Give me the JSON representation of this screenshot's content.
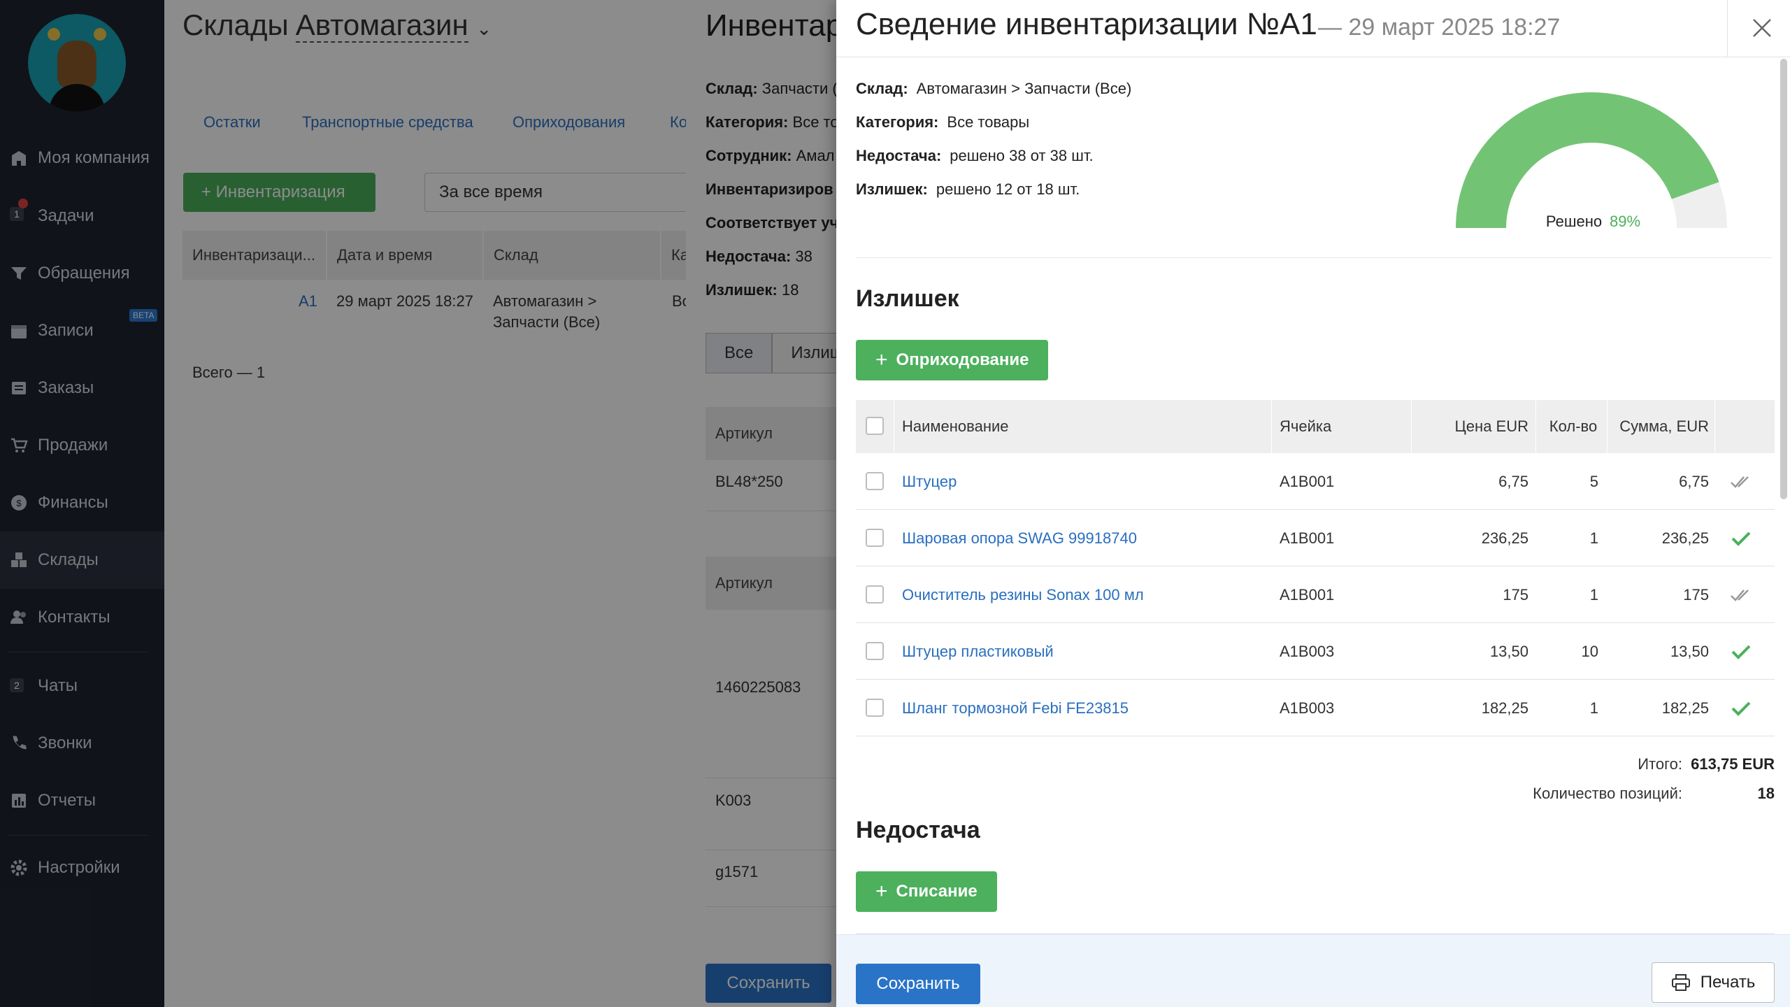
{
  "sidebar": {
    "items": [
      {
        "label": "Моя компания",
        "icon": "building-icon"
      },
      {
        "label": "Задачи",
        "icon": "tasks-icon",
        "badge": "1"
      },
      {
        "label": "Обращения",
        "icon": "funnel-icon"
      },
      {
        "label": "Записи",
        "icon": "calendar-icon",
        "tag": "BETA"
      },
      {
        "label": "Заказы",
        "icon": "orders-icon"
      },
      {
        "label": "Продажи",
        "icon": "cart-icon"
      },
      {
        "label": "Финансы",
        "icon": "coin-icon"
      },
      {
        "label": "Склады",
        "icon": "boxes-icon"
      },
      {
        "label": "Контакты",
        "icon": "contacts-icon"
      },
      {
        "label": "Чаты",
        "icon": "chat-icon",
        "badge": "2"
      },
      {
        "label": "Звонки",
        "icon": "phone-icon"
      },
      {
        "label": "Отчеты",
        "icon": "reports-icon"
      },
      {
        "label": "Настройки",
        "icon": "gear-icon"
      }
    ]
  },
  "main": {
    "title_prefix": "Склады",
    "title_warehouse": "Автомагазин",
    "tabs": [
      "Остатки",
      "Транспортные средства",
      "Оприходования",
      "Ко"
    ],
    "inventory_button": "+ Инвентаризация",
    "period": "За все время",
    "table": {
      "headers": [
        "Инвентаризаци...",
        "Дата и время",
        "Склад",
        "Ка"
      ],
      "rows": [
        [
          "A1",
          "29 март 2025 18:27",
          "Автомагазин > Запчасти (Все)",
          "Во"
        ]
      ]
    },
    "total": "Всего — 1"
  },
  "middle": {
    "title": "Инвентар",
    "fields": [
      {
        "label": "Склад:",
        "value": "Запчасти ("
      },
      {
        "label": "Категория:",
        "value": "Все то"
      },
      {
        "label": "Сотрудник:",
        "value": "Амал"
      },
      {
        "label": "Инвентаризиров",
        "value": ""
      },
      {
        "label": "Соответствует уч",
        "value": ""
      },
      {
        "label": "Недостача:",
        "value": "38"
      },
      {
        "label": "Излишек:",
        "value": "18"
      }
    ],
    "tabs": [
      "Все",
      "Излиш"
    ],
    "col_header": "Артикул",
    "articles": [
      "BL48*250",
      "1460225083",
      "K003",
      "g1571"
    ],
    "save": "Сохранить"
  },
  "dialog": {
    "title": "Сведение инвентаризации №A1",
    "date": "— 29 март 2025 18:27",
    "fields": [
      {
        "label": "Склад:",
        "value": "Автомагазин > Запчасти (Все)"
      },
      {
        "label": "Категория:",
        "value": "Все товары"
      },
      {
        "label": "Недостача:",
        "value": "решено 38 от 38 шт."
      },
      {
        "label": "Излишек:",
        "value": "решено 12 от 18 шт."
      }
    ],
    "gauge": {
      "label": "Решено",
      "value_text": "89%",
      "fraction": 0.89,
      "color": "#72c474",
      "track": "#efefef",
      "value_color": "#4cb05c"
    },
    "surplus": {
      "title": "Излишек",
      "button": "Оприходование",
      "headers": [
        "Наименование",
        "Ячейка",
        "Цена EUR",
        "Кол-во",
        "Сумма, EUR"
      ],
      "rows": [
        {
          "name": "Штуцер",
          "cell": "A1B001",
          "price": "6,75",
          "qty": "5",
          "sum": "6,75",
          "resolved": false
        },
        {
          "name": "Шаровая опора SWAG 99918740",
          "cell": "A1B001",
          "price": "236,25",
          "qty": "1",
          "sum": "236,25",
          "resolved": true
        },
        {
          "name": "Очиститель резины Sonax 100 мл",
          "cell": "A1B001",
          "price": "175",
          "qty": "1",
          "sum": "175",
          "resolved": false
        },
        {
          "name": "Штуцер пластиковый",
          "cell": "A1B003",
          "price": "13,50",
          "qty": "10",
          "sum": "13,50",
          "resolved": true
        },
        {
          "name": "Шланг тормозной Febi FE23815",
          "cell": "A1B003",
          "price": "182,25",
          "qty": "1",
          "sum": "182,25",
          "resolved": true
        }
      ],
      "total_label": "Итого:",
      "total_value": "613,75 EUR",
      "count_label": "Количество позиций:",
      "count_value": "18"
    },
    "shortage": {
      "title": "Недостача",
      "button": "Списание"
    },
    "save": "Сохранить",
    "print": "Печать"
  }
}
